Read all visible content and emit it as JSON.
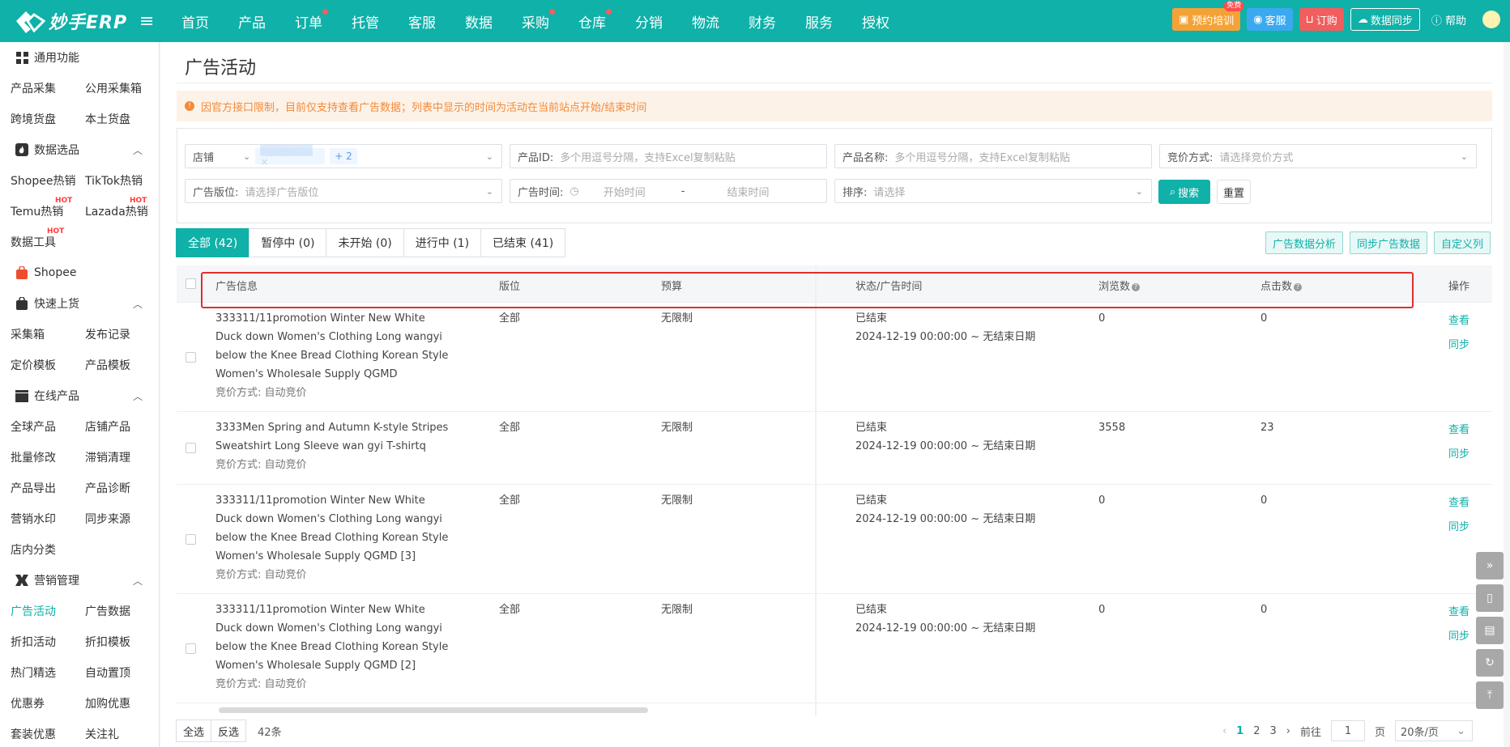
{
  "brand": {
    "name": "妙手ERP"
  },
  "nav": [
    {
      "label": "首页",
      "dot": false
    },
    {
      "label": "产品",
      "dot": false
    },
    {
      "label": "订单",
      "dot": true
    },
    {
      "label": "托管",
      "dot": false
    },
    {
      "label": "客服",
      "dot": false
    },
    {
      "label": "数据",
      "dot": false
    },
    {
      "label": "采购",
      "dot": true
    },
    {
      "label": "仓库",
      "dot": true
    },
    {
      "label": "分销",
      "dot": false
    },
    {
      "label": "物流",
      "dot": false
    },
    {
      "label": "财务",
      "dot": false
    },
    {
      "label": "服务",
      "dot": false
    },
    {
      "label": "授权",
      "dot": false
    }
  ],
  "topright": {
    "training": "预约培训",
    "free_badge": "免费",
    "service": "客服",
    "order": "订购",
    "sync": "数据同步",
    "help": "帮助"
  },
  "sidebar": {
    "general": "通用功能",
    "general_items": [
      "产品采集",
      "公用采集箱",
      "跨境货盘",
      "本土货盘"
    ],
    "data_select": "数据选品",
    "data_items": [
      "Shopee热销",
      "TikTok热销",
      "Temu热销",
      "Lazada热销",
      "数据工具"
    ],
    "hot_label": "HOT",
    "shopee": "Shopee",
    "quick": "快速上货",
    "quick_items": [
      "采集箱",
      "发布记录",
      "定价模板",
      "产品模板"
    ],
    "online": "在线产品",
    "online_items": [
      "全球产品",
      "店铺产品",
      "批量修改",
      "滞销清理",
      "产品导出",
      "产品诊断",
      "营销水印",
      "同步来源",
      "店内分类"
    ],
    "marketing": "营销管理",
    "marketing_items": [
      "广告活动",
      "广告数据",
      "折扣活动",
      "折扣模板",
      "热门精选",
      "自动置顶",
      "优惠券",
      "加购优惠",
      "套装优惠",
      "关注礼"
    ]
  },
  "page": {
    "title": "广告活动",
    "notice": "因官方接口限制，目前仅支持查看广告数据；列表中显示的时间为活动在当前站点开始/结束时间"
  },
  "filters": {
    "shop_label": "店铺",
    "shop_more": "+ 2",
    "product_id_label": "产品ID:",
    "product_id_ph": "多个用逗号分隔，支持Excel复制粘贴",
    "product_name_label": "产品名称:",
    "product_name_ph": "多个用逗号分隔，支持Excel复制粘贴",
    "bid_label": "竞价方式:",
    "bid_ph": "请选择竞价方式",
    "slot_label": "广告版位:",
    "slot_ph": "请选择广告版位",
    "time_label": "广告时间:",
    "start_ph": "开始时间",
    "sep": "-",
    "end_ph": "结束时间",
    "sort_label": "排序:",
    "sort_ph": "请选择",
    "search": "搜索",
    "reset": "重置"
  },
  "tabs": [
    "全部 (42)",
    "暂停中 (0)",
    "未开始 (0)",
    "进行中 (1)",
    "已结束 (41)"
  ],
  "tools": [
    "广告数据分析",
    "同步广告数据",
    "自定义列"
  ],
  "table": {
    "headers": {
      "info": "广告信息",
      "slot": "版位",
      "budget": "预算",
      "status": "状态/广告时间",
      "views": "浏览数",
      "clicks": "点击数",
      "ops": "操作"
    },
    "rows": [
      {
        "title": "333311/11promotion Winter New White Duck down Women's Clothing Long wangyi below the Knee Bread Clothing Korean Style Women's Wholesale Supply QGMD",
        "bid": "竞价方式:  自动竞价",
        "slot": "全部",
        "budget": "无限制",
        "status": "已结束",
        "time": "2024-12-19 00:00:00 ~ 无结束日期",
        "views": "0",
        "clicks": "0"
      },
      {
        "title": "3333Men Spring and Autumn K-style Stripes Sweatshirt Long Sleeve wan gyi T-shirtq",
        "bid": "竞价方式:  自动竞价",
        "slot": "全部",
        "budget": "无限制",
        "status": "已结束",
        "time": "2024-12-19 00:00:00 ~ 无结束日期",
        "views": "3558",
        "clicks": "23"
      },
      {
        "title": "333311/11promotion Winter New White Duck down Women's Clothing Long wangyi below the Knee Bread Clothing Korean Style Women's Wholesale Supply QGMD [3]",
        "bid": "竞价方式:  自动竞价",
        "slot": "全部",
        "budget": "无限制",
        "status": "已结束",
        "time": "2024-12-19 00:00:00 ~ 无结束日期",
        "views": "0",
        "clicks": "0"
      },
      {
        "title": "333311/11promotion Winter New White Duck down Women's Clothing Long wangyi below the Knee Bread Clothing Korean Style Women's Wholesale Supply QGMD [2]",
        "bid": "竞价方式:  自动竞价",
        "slot": "全部",
        "budget": "无限制",
        "status": "已结束",
        "time": "2024-12-19 00:00:00 ~ 无结束日期",
        "views": "0",
        "clicks": "0"
      }
    ],
    "op_view": "查看",
    "op_sync": "同步"
  },
  "footer": {
    "select_all": "全选",
    "invert": "反选",
    "count": "42条"
  },
  "pager": {
    "pages": [
      "1",
      "2",
      "3"
    ],
    "goto": "前往",
    "goto_value": "1",
    "page_unit": "页",
    "size": "20条/页"
  },
  "colors": {
    "primary": "#0fb1a9",
    "highlight_box": "#e02f2f",
    "notice_text": "#f28a3a"
  }
}
